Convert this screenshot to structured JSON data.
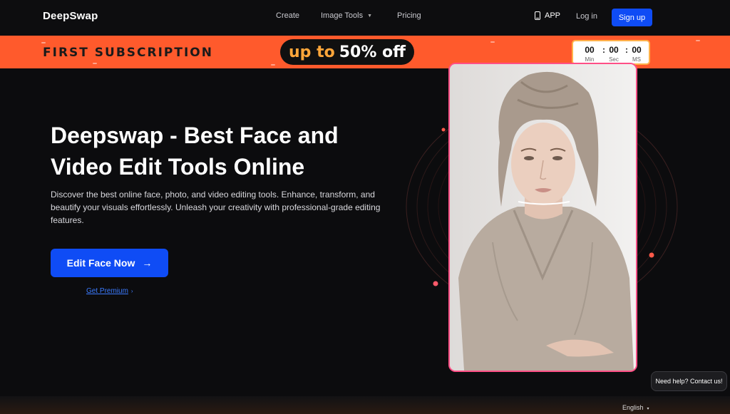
{
  "nav": {
    "logo": "DeepSwap",
    "links": [
      {
        "label": "Create"
      },
      {
        "label": "Image Tools"
      },
      {
        "label": "Pricing"
      }
    ],
    "app_label": "APP",
    "login_label": "Log in",
    "signup_label": "Sign up"
  },
  "promo": {
    "title": "FIRST SUBSCRIPTION",
    "up_to": "up to",
    "percent_off": "50% off",
    "countdown": {
      "min": "00",
      "sec": "00",
      "ms": "00",
      "min_label": "Min",
      "sec_label": "Sec",
      "ms_label": "MS",
      "separator": ":"
    }
  },
  "hero": {
    "title": "Deepswap - Best Face and Video Edit Tools Online",
    "description": "Discover the best online face, photo, and video editing tools. Enhance, transform, and beautify your visuals effortlessly. Unleash your creativity with professional-grade editing features.",
    "cta_label": "Edit Face Now",
    "cta_arrow": "→",
    "premium_label": "Get Premium",
    "premium_chevron": "›"
  },
  "help": {
    "label": "Need help? Contact us!"
  },
  "footer": {
    "language": "English",
    "language_caret": "▾"
  },
  "colors": {
    "accent_blue": "#0f4cf5",
    "promo_orange": "#ff5a2c",
    "card_border": "#ff4f86",
    "background": "#0c0c0e"
  },
  "icons": [
    "phone-icon",
    "arrow-right-icon",
    "chevron-right-icon",
    "caret-down-icon"
  ]
}
